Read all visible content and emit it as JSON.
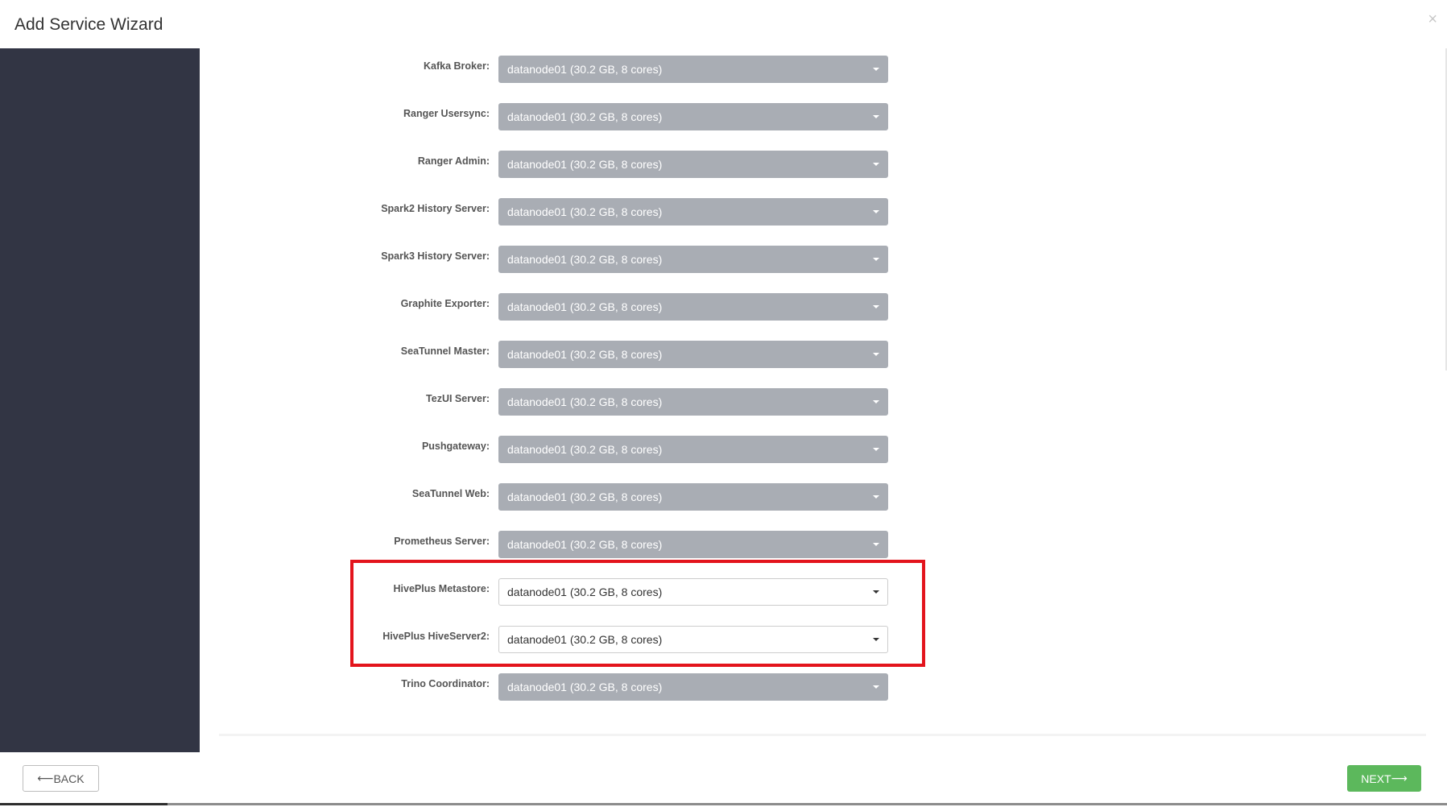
{
  "window": {
    "title": "Add Service Wizard",
    "close_glyph": "×"
  },
  "assignments": [
    {
      "label": "Kafka Broker:",
      "value": "datanode01 (30.2 GB, 8 cores)"
    },
    {
      "label": "Ranger Usersync:",
      "value": "datanode01 (30.2 GB, 8 cores)"
    },
    {
      "label": "Ranger Admin:",
      "value": "datanode01 (30.2 GB, 8 cores)"
    },
    {
      "label": "Spark2 History Server:",
      "value": "datanode01 (30.2 GB, 8 cores)"
    },
    {
      "label": "Spark3 History Server:",
      "value": "datanode01 (30.2 GB, 8 cores)"
    },
    {
      "label": "Graphite Exporter:",
      "value": "datanode01 (30.2 GB, 8 cores)"
    },
    {
      "label": "SeaTunnel Master:",
      "value": "datanode01 (30.2 GB, 8 cores)"
    },
    {
      "label": "TezUI Server:",
      "value": "datanode01 (30.2 GB, 8 cores)"
    },
    {
      "label": "Pushgateway:",
      "value": "datanode01 (30.2 GB, 8 cores)"
    },
    {
      "label": "SeaTunnel Web:",
      "value": "datanode01 (30.2 GB, 8 cores)"
    },
    {
      "label": "Prometheus Server:",
      "value": "datanode01 (30.2 GB, 8 cores)"
    },
    {
      "label": "HivePlus Metastore:",
      "value": "datanode01 (30.2 GB, 8 cores)"
    },
    {
      "label": "HivePlus HiveServer2:",
      "value": "datanode01 (30.2 GB, 8 cores)"
    },
    {
      "label": "Trino Coordinator:",
      "value": "datanode01 (30.2 GB, 8 cores)"
    }
  ],
  "footer": {
    "back_label": "BACK",
    "back_arrow": "⟵",
    "next_label": "NEXT",
    "next_arrow": "⟶"
  },
  "colors": {
    "sidebar": "#323544",
    "disabled_select": "#a9adb4",
    "highlight": "#e3141c",
    "next_button": "#5cb85c"
  },
  "icons": {
    "dropdown": "caret-down-icon",
    "close": "close-icon"
  }
}
